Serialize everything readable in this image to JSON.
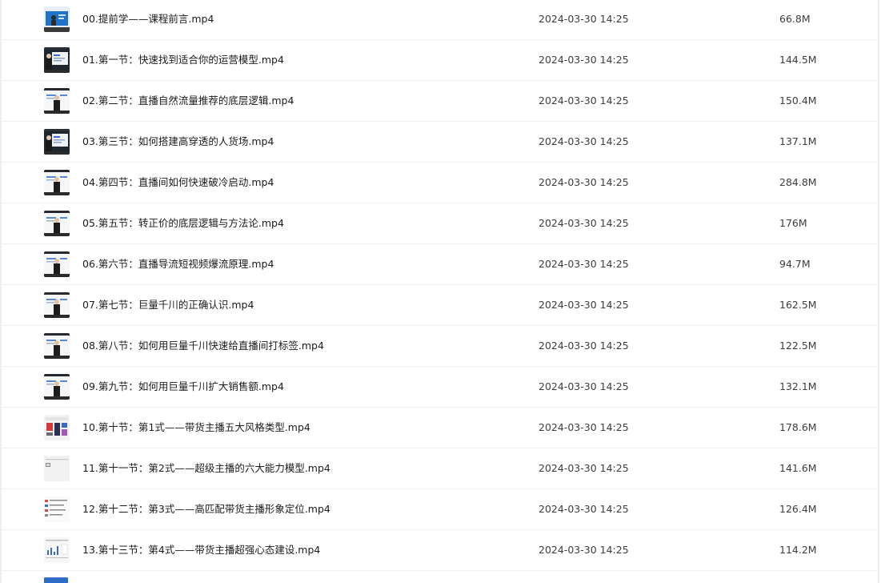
{
  "files": [
    {
      "name": "00.提前学——课程前言.mp4",
      "modified": "2024-03-30 14:25",
      "size": "66.8M",
      "thumb": "blue-screen"
    },
    {
      "name": "01.第一节：快速找到适合你的运营模型.mp4",
      "modified": "2024-03-30 14:25",
      "size": "144.5M",
      "thumb": "presenter-dark"
    },
    {
      "name": "02.第二节：直播自然流量推荐的底层逻辑.mp4",
      "modified": "2024-03-30 14:25",
      "size": "150.4M",
      "thumb": "presenter-light"
    },
    {
      "name": "03.第三节：如何搭建高穿透的人货场.mp4",
      "modified": "2024-03-30 14:25",
      "size": "137.1M",
      "thumb": "presenter-dark"
    },
    {
      "name": "04.第四节：直播间如何快速破冷启动.mp4",
      "modified": "2024-03-30 14:25",
      "size": "284.8M",
      "thumb": "presenter-light"
    },
    {
      "name": "05.第五节：转正价的底层逻辑与方法论.mp4",
      "modified": "2024-03-30 14:25",
      "size": "176M",
      "thumb": "presenter-light"
    },
    {
      "name": "06.第六节：直播导流短视频爆流原理.mp4",
      "modified": "2024-03-30 14:25",
      "size": "94.7M",
      "thumb": "presenter-light"
    },
    {
      "name": "07.第七节：巨量千川的正确认识.mp4",
      "modified": "2024-03-30 14:25",
      "size": "162.5M",
      "thumb": "presenter-light"
    },
    {
      "name": "08.第八节：如何用巨量千川快速给直播间打标签.mp4",
      "modified": "2024-03-30 14:25",
      "size": "122.5M",
      "thumb": "presenter-light"
    },
    {
      "name": "09.第九节：如何用巨量千川扩大销售额.mp4",
      "modified": "2024-03-30 14:25",
      "size": "132.1M",
      "thumb": "presenter-light"
    },
    {
      "name": "10.第十节：第1式——带货主播五大风格类型.mp4",
      "modified": "2024-03-30 14:25",
      "size": "178.6M",
      "thumb": "slide-dark"
    },
    {
      "name": "11.第十一节：第2式——超级主播的六大能力模型.mp4",
      "modified": "2024-03-30 14:25",
      "size": "141.6M",
      "thumb": "slide-blank"
    },
    {
      "name": "12.第十二节：第3式——高匹配带货主播形象定位.mp4",
      "modified": "2024-03-30 14:25",
      "size": "126.4M",
      "thumb": "slide-table"
    },
    {
      "name": "13.第十三节：第4式——带货主播超强心态建设.mp4",
      "modified": "2024-03-30 14:25",
      "size": "114.2M",
      "thumb": "slide-chart"
    }
  ]
}
